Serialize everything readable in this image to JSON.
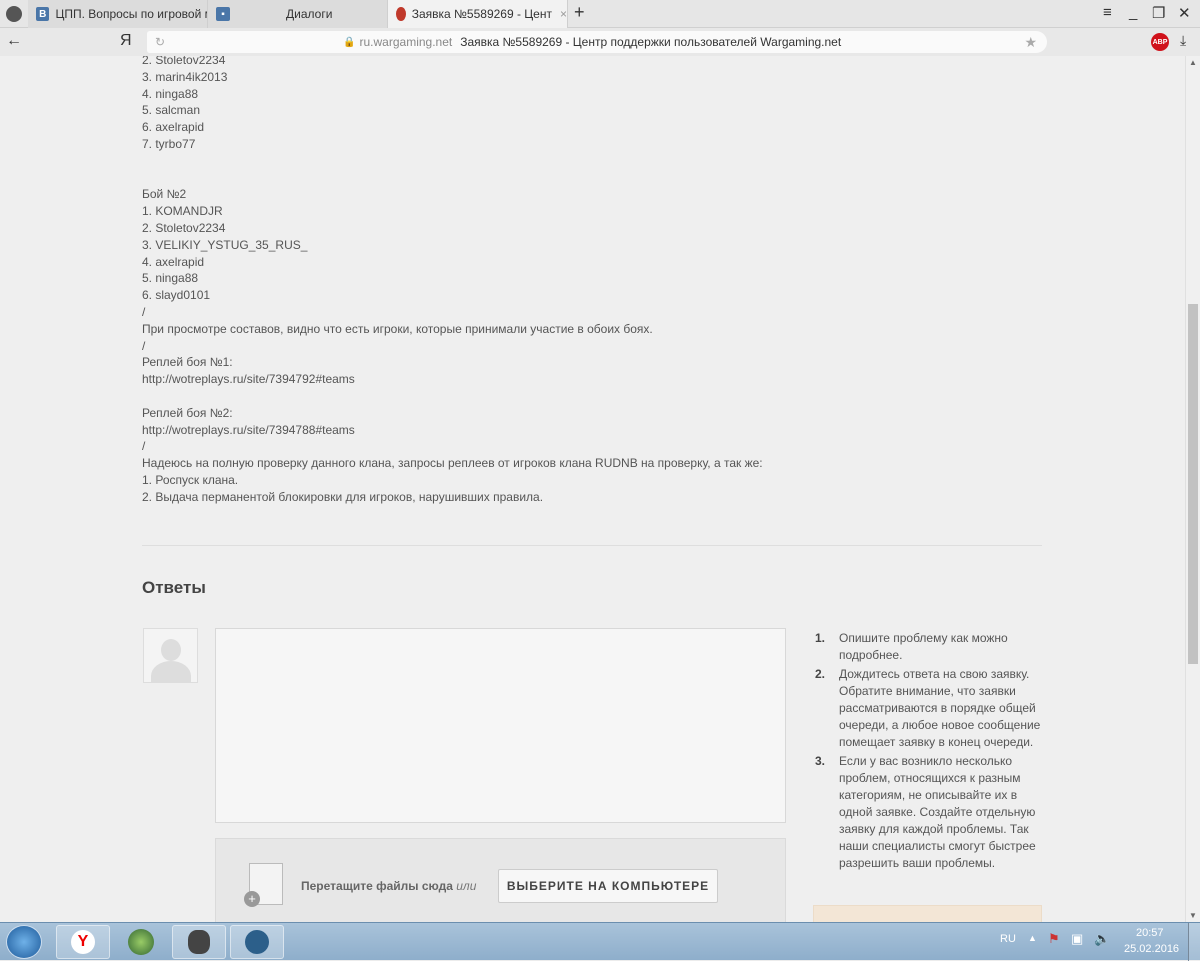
{
  "browser": {
    "tabs": [
      {
        "label": "ЦПП. Вопросы по игровой м",
        "icon": "vk-icon"
      },
      {
        "label": "Диалоги",
        "icon": "vk-dialogs-icon"
      },
      {
        "label": "Заявка №5589269 - Цент",
        "icon": "wargaming-icon"
      }
    ],
    "yandex_logo": "Я",
    "domain": "ru.wargaming.net",
    "page_title": "Заявка №5589269 - Центр поддержки пользователей Wargaming.net",
    "abp": "ABP"
  },
  "ticket": {
    "lines": [
      "2. Stoletov2234",
      "3. marin4ik2013",
      "4. ninga88",
      "5. salcman",
      "6. axelrapid",
      "7. tyrbo77",
      "",
      "",
      "Бой №2",
      "1. KOMANDJR",
      "2. Stoletov2234",
      "3. VELIKIY_YSTUG_35_RUS_",
      "4. axelrapid",
      "5. ninga88",
      "6. slayd0101",
      "/",
      "При просмотре составов, видно что есть игроки, которые принимали участие в обоих боях.",
      "/",
      "Реплей боя №1:",
      "http://wotreplays.ru/site/7394792#teams",
      "",
      "Реплей боя №2:",
      "http://wotreplays.ru/site/7394788#teams",
      "/",
      "Надеюсь на полную проверку данного клана, запросы реплеев от игроков клана RUDNB на проверку, а так же:",
      "1. Роспуск клана.",
      "2. Выдача перманентой блокировки для игроков, нарушивших правила."
    ]
  },
  "answers": {
    "title": "Ответы",
    "drop_text": "Перетащите файлы сюда",
    "drop_or": "или",
    "pick_button": "ВЫБЕРИТЕ НА КОМПЬЮТЕРЕ"
  },
  "tips": [
    {
      "n": "1.",
      "text": "Опишите проблему как можно подробнее."
    },
    {
      "n": "2.",
      "text": "Дождитесь ответа на свою заявку. Обратите внимание, что заявки рассматриваются в порядке общей очереди, а любое новое сообщение помещает заявку в конец очереди."
    },
    {
      "n": "3.",
      "text": "Если у вас возникло несколько проблем, относящихся к разным категориям, не описывайте их в одной заявке. Создайте отдельную заявку для каждой проблемы. Так наши специалисты смогут быстрее разрешить ваши проблемы."
    }
  ],
  "taskbar": {
    "lang": "RU",
    "time": "20:57",
    "date": "25.02.2016"
  }
}
